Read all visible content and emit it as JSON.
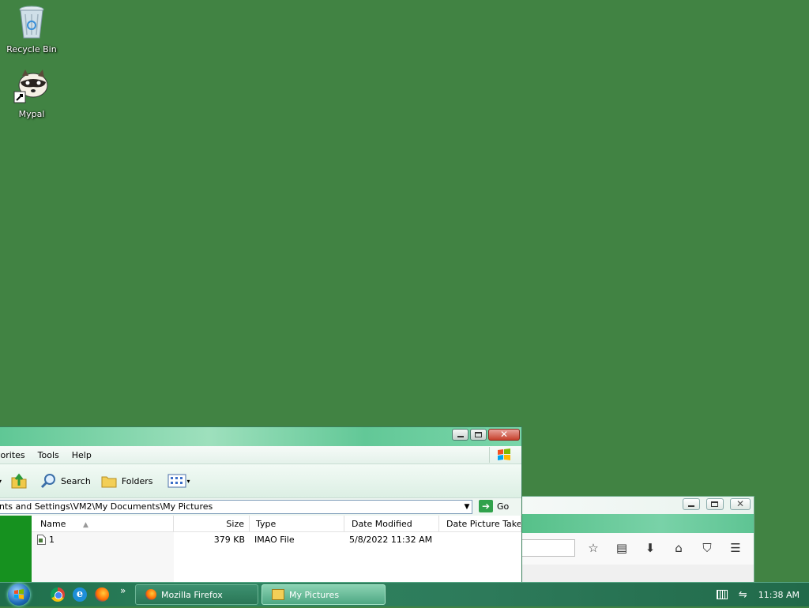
{
  "desktop": {
    "icons": [
      {
        "label": "Recycle Bin",
        "icon": "recycle-bin-icon"
      },
      {
        "label": "Mypal",
        "icon": "raccoon-shortcut-icon"
      }
    ]
  },
  "explorer": {
    "menu": [
      "vorites",
      "Tools",
      "Help"
    ],
    "toolbar": {
      "search_label": "Search",
      "folders_label": "Folders"
    },
    "address": {
      "value": "nts and Settings\\VM2\\My Documents\\My Pictures",
      "go_label": "Go"
    },
    "columns": [
      "Name",
      "Size",
      "Type",
      "Date Modified",
      "Date Picture Taken"
    ],
    "rows": [
      {
        "name": "1",
        "size": "379 KB",
        "type": "IMAO File",
        "modified": "5/8/2022 11:32 AM",
        "taken": ""
      }
    ]
  },
  "firefox": {
    "nav_icons": [
      "star-icon",
      "clipboard-icon",
      "download-icon",
      "home-icon",
      "pocket-icon",
      "menu-icon"
    ]
  },
  "taskbar": {
    "tasks": [
      {
        "label": "Mozilla Firefox",
        "active": false
      },
      {
        "label": "My Pictures",
        "active": true
      }
    ],
    "clock": "11:38 AM",
    "more": "»"
  },
  "colors": {
    "desktop": "#418343",
    "task_pane": "#16911f"
  }
}
